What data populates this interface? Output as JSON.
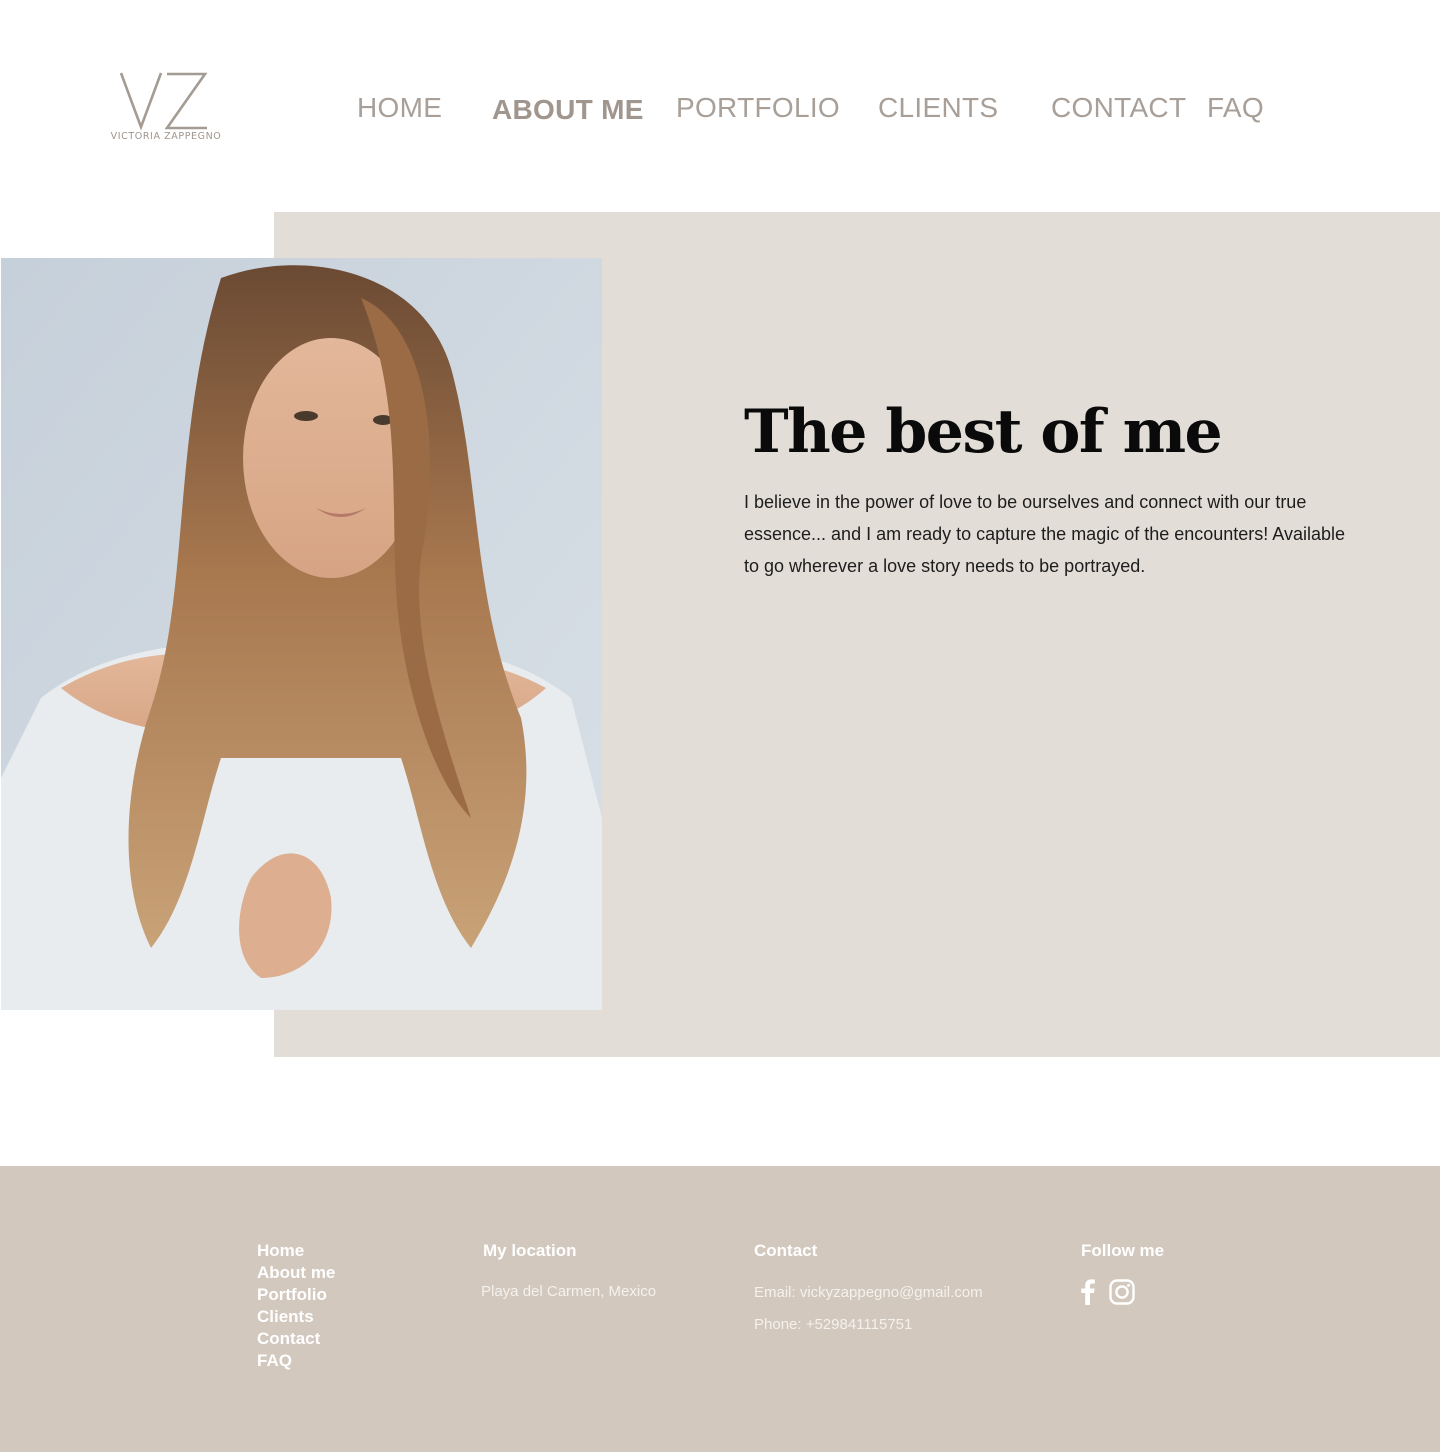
{
  "brand": {
    "logo_text": "VICTORIA ZAPPEGNO"
  },
  "nav": {
    "items": [
      {
        "label": "HOME"
      },
      {
        "label": "ABOUT ME"
      },
      {
        "label": "PORTFOLIO"
      },
      {
        "label": "CLIENTS"
      },
      {
        "label": "CONTACT"
      },
      {
        "label": "FAQ"
      }
    ],
    "active": "ABOUT ME"
  },
  "hero": {
    "title": "The best of me",
    "paragraph": "I believe in the power of love to be ourselves and connect with our true essence... and I am ready to capture the magic of the encounters! Available to go wherever a love story needs to be portrayed.",
    "image_alt": "portrait"
  },
  "footer": {
    "links": [
      "Home",
      "About me",
      "Portfolio",
      "Clients",
      "Contact",
      "FAQ"
    ],
    "location": {
      "heading": "My location",
      "value": "Playa del Carmen, Mexico"
    },
    "contact": {
      "heading": "Contact",
      "email": "Email: vickyzappegno@gmail.com",
      "phone": "Phone: +529841115751"
    },
    "follow": {
      "heading": "Follow me",
      "icons": [
        "facebook-icon",
        "instagram-icon"
      ]
    }
  },
  "colors": {
    "nav_text": "#a79f98",
    "hero_bg": "#e2ddd7",
    "footer_bg": "#d2c8be"
  }
}
